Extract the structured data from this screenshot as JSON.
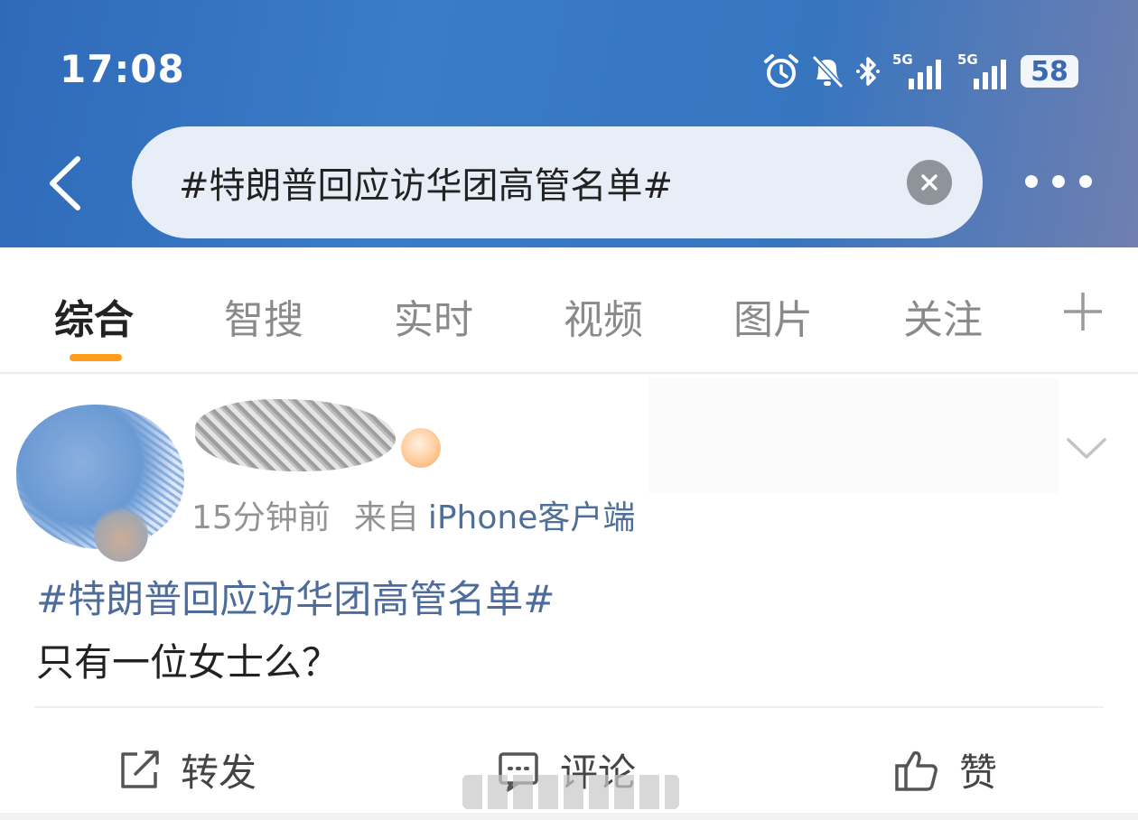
{
  "status_bar": {
    "time": "17:08",
    "signal1_label": "5G",
    "signal2_label": "5G",
    "battery": "58",
    "icons": [
      "alarm-icon",
      "mute-bell-icon",
      "bluetooth-icon",
      "signal-5g-icon",
      "signal-5g-icon",
      "battery-icon"
    ]
  },
  "search": {
    "query": "#特朗普回应访华团高管名单#"
  },
  "tabs": [
    {
      "label": "综合",
      "active": true
    },
    {
      "label": "智搜"
    },
    {
      "label": "实时"
    },
    {
      "label": "视频"
    },
    {
      "label": "图片"
    },
    {
      "label": "关注"
    }
  ],
  "post": {
    "time": "15分钟前",
    "source_prefix": "来自",
    "source_client": "iPhone客户端",
    "hashtag": "#特朗普回应访华团高管名单#",
    "text": "只有一位女士么？"
  },
  "actions": {
    "repost": "转发",
    "comment": "评论",
    "like": "赞"
  },
  "colors": {
    "header_blue": "#3775bf",
    "tab_indicator": "#ff9c1a",
    "link_blue": "#4d6c9b"
  }
}
